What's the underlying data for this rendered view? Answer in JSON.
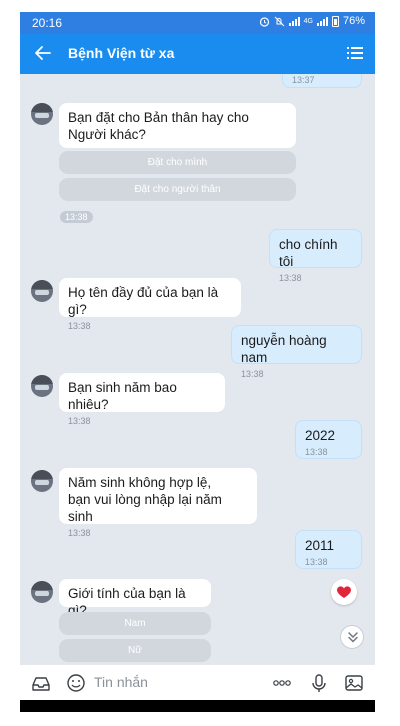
{
  "status_bar": {
    "time": "20:16",
    "network_1": "4G",
    "battery": "76%"
  },
  "header": {
    "title": "Bệnh Viện từ xa"
  },
  "messages": {
    "m0": {
      "time": "13:37"
    },
    "m1": {
      "text": "Bạn đặt cho Bản thân hay cho Người khác?"
    },
    "m1_options": [
      "Đặt cho mình",
      "Đặt cho người thân"
    ],
    "m1_time": "13:38",
    "m2": {
      "text": "cho chính tôi",
      "time": "13:38"
    },
    "m3": {
      "text": "Họ tên đầy đủ của bạn là gì?",
      "time": "13:38"
    },
    "m4": {
      "text": "nguyễn hoàng nam",
      "time": "13:38"
    },
    "m5": {
      "text": "Bạn sinh năm bao nhiêu?",
      "time": "13:38"
    },
    "m6": {
      "text": "2022",
      "time": "13:38"
    },
    "m7": {
      "text": "Năm sinh không hợp lệ,\nbạn vui lòng nhập lại năm sinh",
      "time": "13:38"
    },
    "m8": {
      "text": "2011",
      "time": "13:38"
    },
    "m9": {
      "text": "Giới tính của bạn là gì?"
    },
    "m9_options": [
      "Nam",
      "Nữ"
    ]
  },
  "composer": {
    "placeholder": "Tin nhắn"
  },
  "colors": {
    "header": "#1a8cf0",
    "status_bar": "#2f7fe3",
    "my_bubble": "#d7ecfd",
    "chat_bg": "#e3e8ef"
  }
}
